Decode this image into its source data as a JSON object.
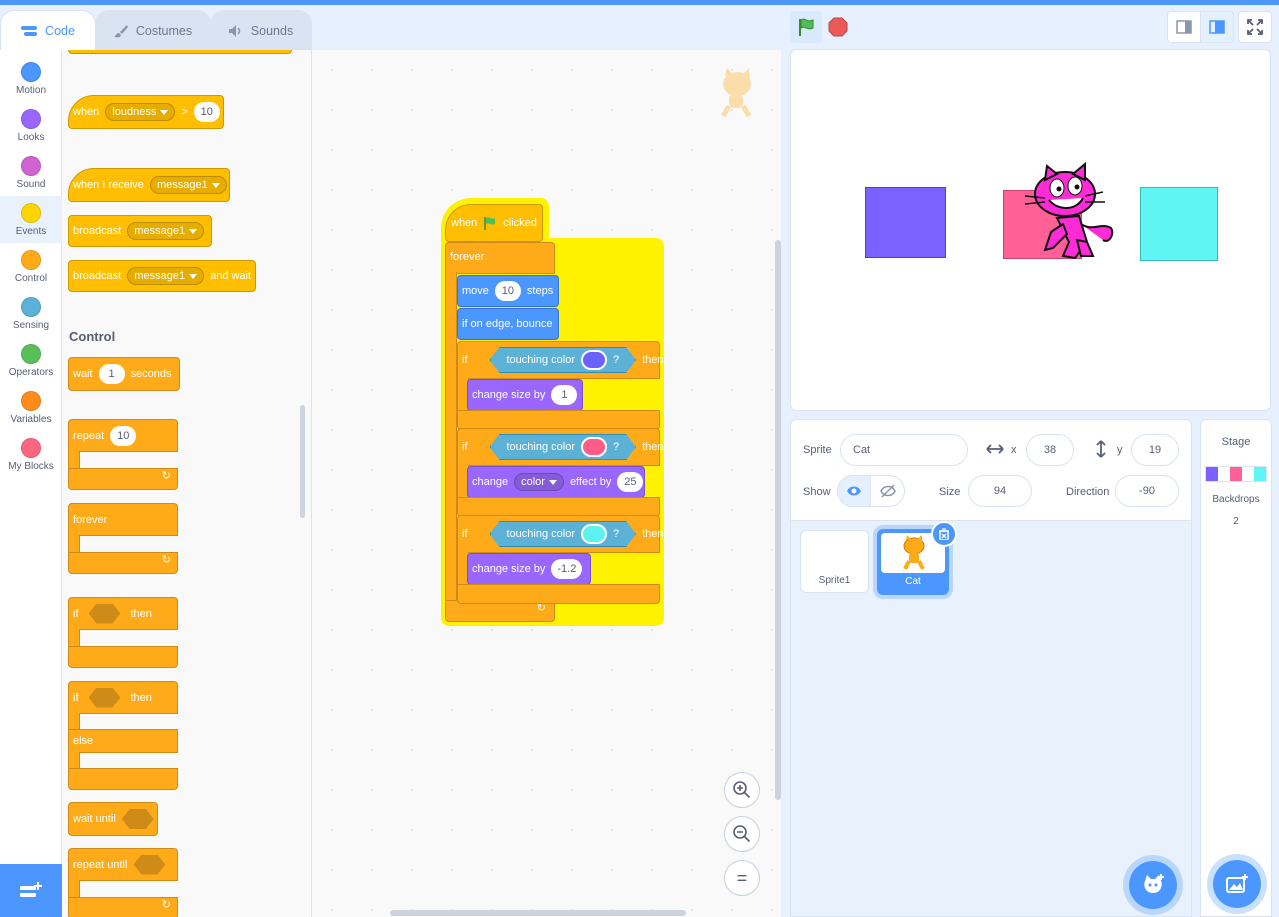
{
  "tabs": [
    {
      "label": "Code"
    },
    {
      "label": "Costumes"
    },
    {
      "label": "Sounds"
    }
  ],
  "categories": [
    {
      "label": "Motion",
      "color": "#4c97ff"
    },
    {
      "label": "Looks",
      "color": "#9966ff"
    },
    {
      "label": "Sound",
      "color": "#cf63cf"
    },
    {
      "label": "Events",
      "color": "#ffd500"
    },
    {
      "label": "Control",
      "color": "#ffab19"
    },
    {
      "label": "Sensing",
      "color": "#5cb1d6"
    },
    {
      "label": "Operators",
      "color": "#59c059"
    },
    {
      "label": "Variables",
      "color": "#ff8c1a"
    },
    {
      "label": "My Blocks",
      "color": "#ff6680"
    }
  ],
  "palette": {
    "when_loudness": {
      "when": "when",
      "menu": "loudness",
      "gt": ">",
      "value": "10"
    },
    "when_receive": {
      "label": "when I receive",
      "menu": "message1"
    },
    "broadcast": {
      "label": "broadcast",
      "menu": "message1"
    },
    "broadcast_wait": {
      "label": "broadcast",
      "menu": "message1",
      "suffix": "and wait"
    },
    "control_title": "Control",
    "wait": {
      "label": "wait",
      "value": "1",
      "suffix": "seconds"
    },
    "repeat": {
      "label": "repeat",
      "value": "10"
    },
    "forever": "forever",
    "if_then": {
      "if": "if",
      "then": "then"
    },
    "if_else": {
      "if": "if",
      "then": "then",
      "else": "else"
    },
    "wait_until": "wait until",
    "repeat_until": "repeat until"
  },
  "script": {
    "hat": {
      "when": "when",
      "clicked": "clicked"
    },
    "forever": "forever",
    "move": {
      "label": "move",
      "value": "10",
      "suffix": "steps"
    },
    "bounce": "if on edge, bounce",
    "if1": {
      "if": "if",
      "cond": "touching color",
      "q": "?",
      "then": "then",
      "swatch": "#6b62ff"
    },
    "size1": {
      "label": "change size by",
      "value": "1"
    },
    "if2": {
      "if": "if",
      "cond": "touching color",
      "q": "?",
      "then": "then",
      "swatch": "#ff5c8a"
    },
    "effect": {
      "label": "change",
      "menu": "color",
      "mid": "effect by",
      "value": "25"
    },
    "if3": {
      "if": "if",
      "cond": "touching color",
      "q": "?",
      "then": "then",
      "swatch": "#5cf2f2"
    },
    "size2": {
      "label": "change size by",
      "value": "-1.2"
    }
  },
  "stage_objects": {
    "purple": "#7b61ff",
    "pink": "#ff6196",
    "cyan": "#5ff5f5"
  },
  "sprite_info": {
    "sprite_label": "Sprite",
    "sprite_name": "Cat",
    "x_label": "x",
    "x": "38",
    "y_label": "y",
    "y": "19",
    "show_label": "Show",
    "size_label": "Size",
    "size": "94",
    "direction_label": "Direction",
    "direction": "-90"
  },
  "sprites": [
    {
      "name": "Sprite1"
    },
    {
      "name": "Cat"
    }
  ],
  "stage_pane": {
    "title": "Stage",
    "backdrops_label": "Backdrops",
    "backdrops_count": "2"
  },
  "zoom": {
    "reset_label": "="
  }
}
